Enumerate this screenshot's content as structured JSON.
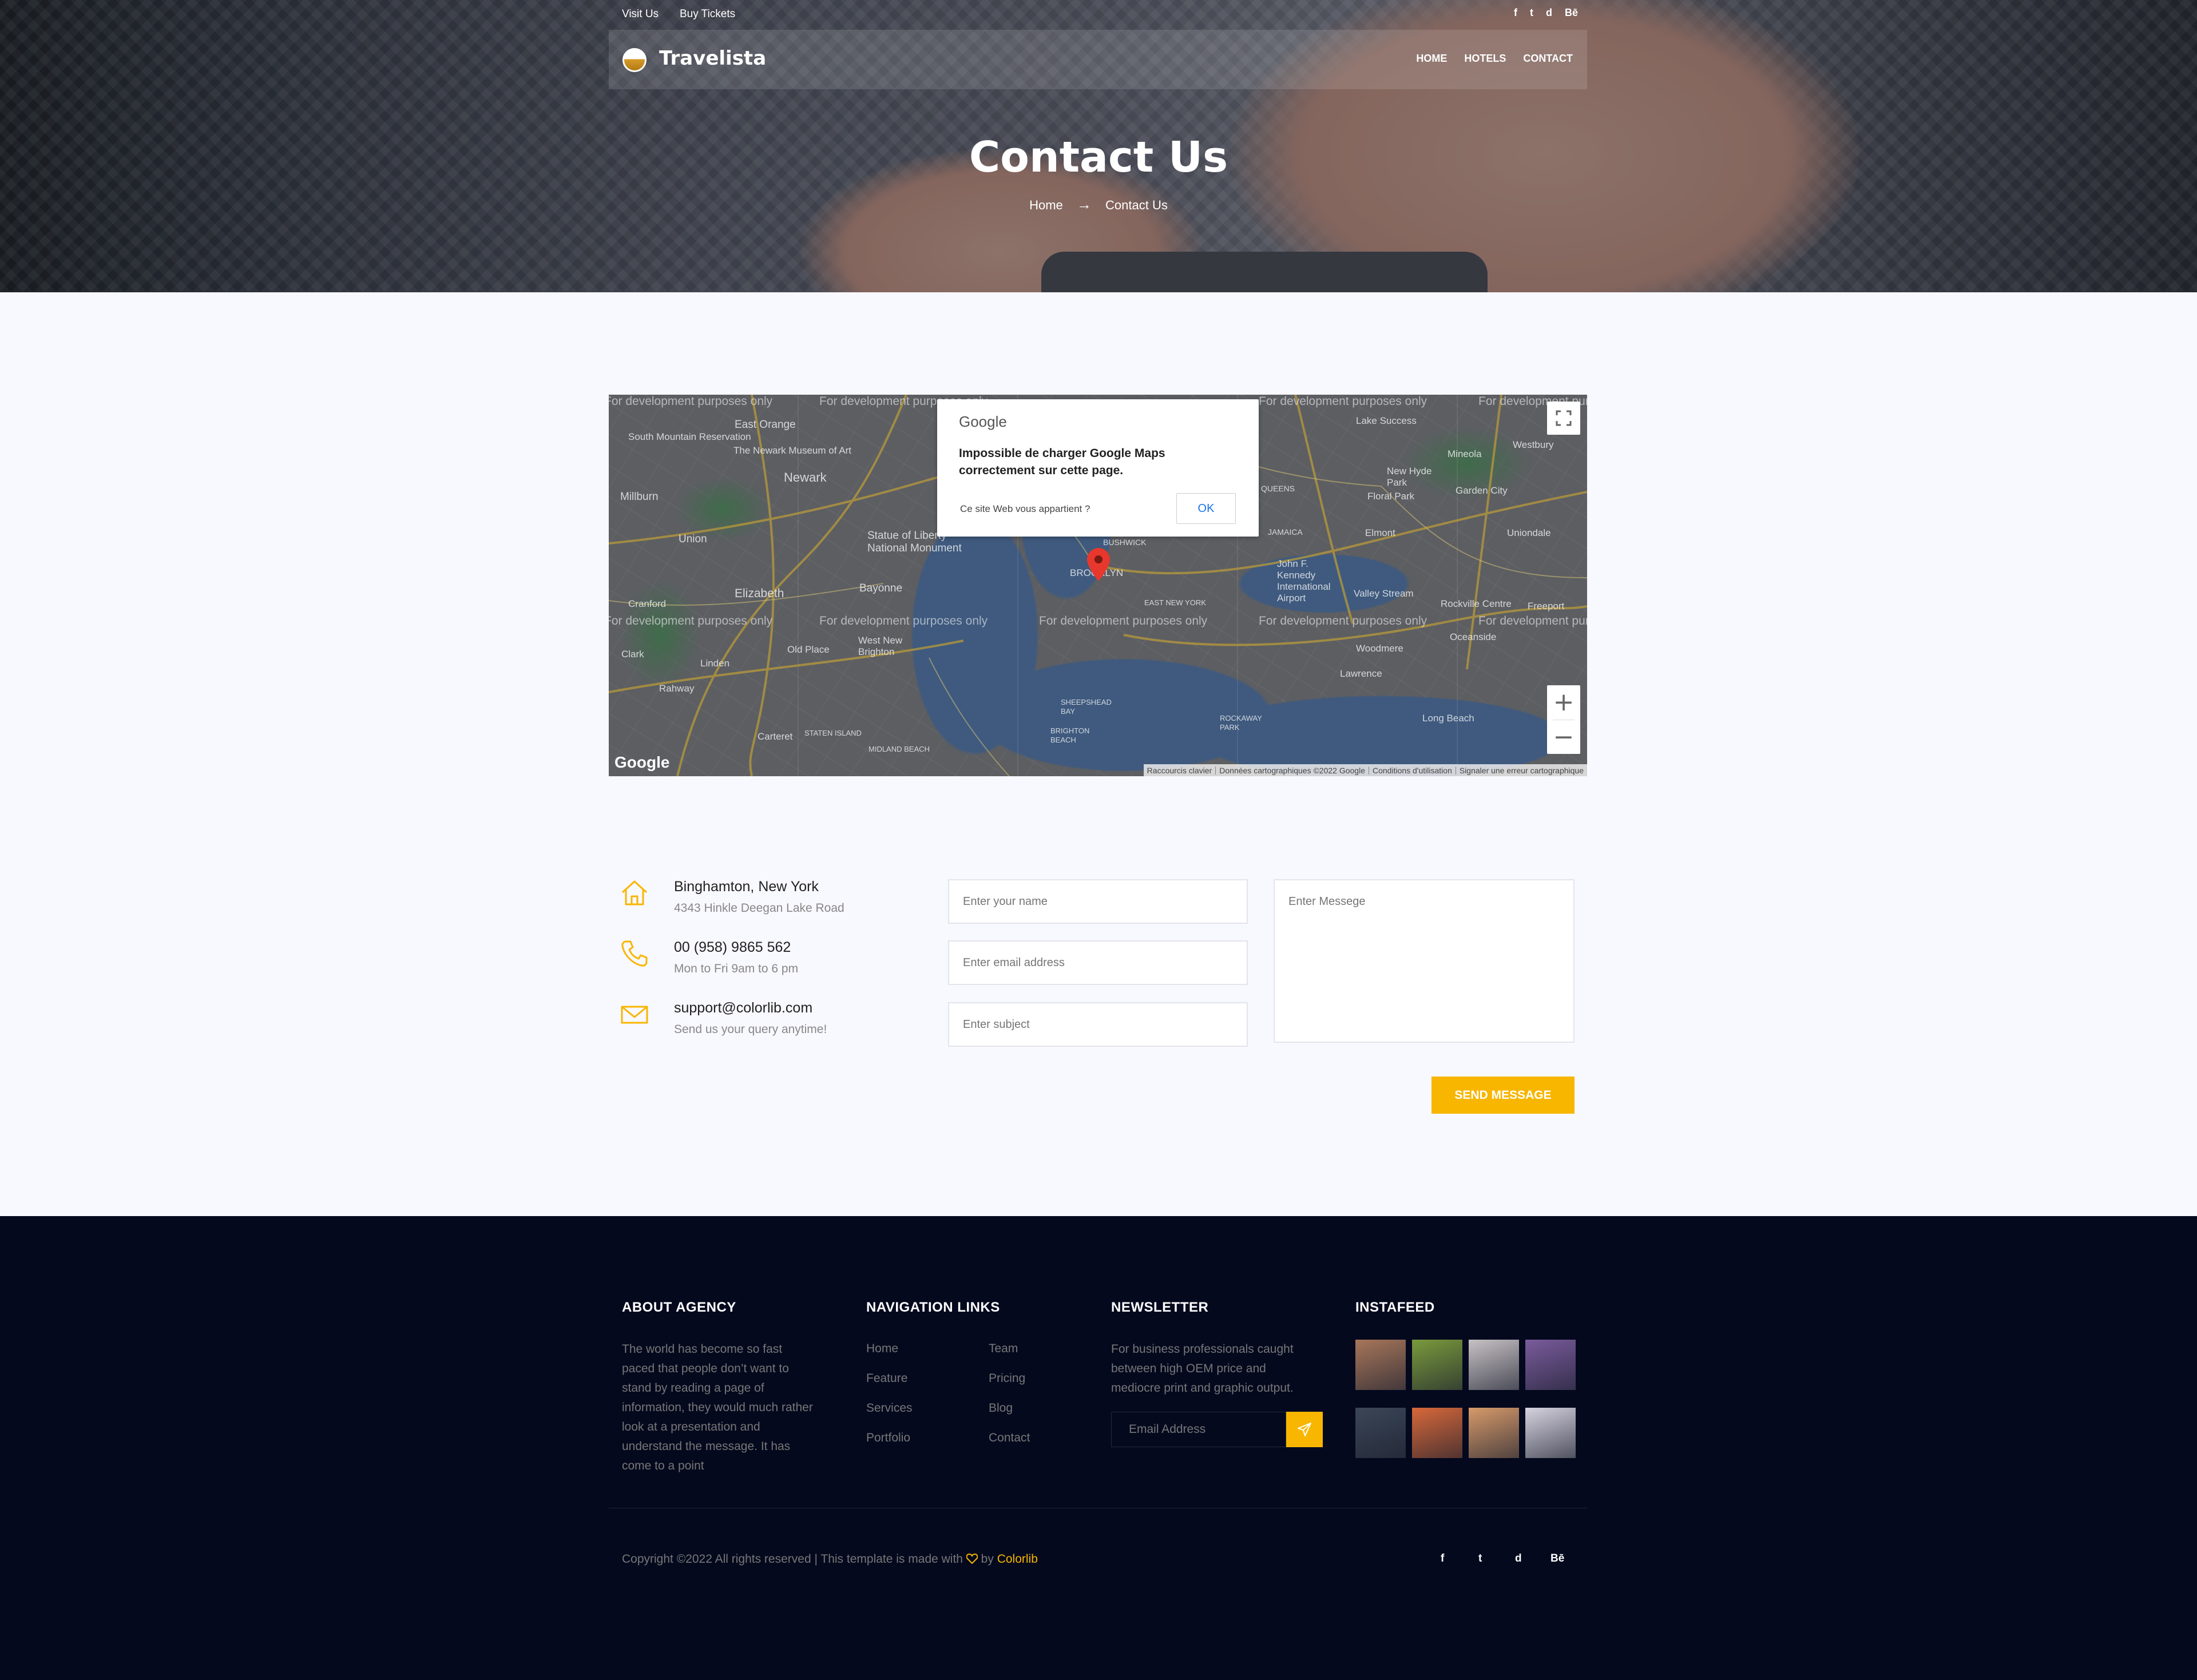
{
  "topbar": {
    "links": [
      "Visit Us",
      "Buy Tickets"
    ],
    "social": [
      "f",
      "t",
      "d",
      "Bē"
    ]
  },
  "navbar": {
    "brand": "Travelista",
    "menu": [
      "HOME",
      "HOTELS",
      "CONTACT"
    ]
  },
  "hero": {
    "title": "Contact Us",
    "breadcrumb": [
      "Home",
      "Contact Us"
    ],
    "breadcrumb_separator_icon": "arrow-right-icon"
  },
  "map": {
    "watermark": "For development purposes only",
    "places": [
      "East Orange",
      "South Mountain Reservation",
      "The Newark Museum of Art",
      "Newark",
      "Millburn",
      "Union",
      "Elizabeth",
      "Cranford",
      "Clark",
      "Linden",
      "Rahway",
      "Carteret",
      "Statue of Liberty National Monument",
      "Bayonne",
      "West New Brighton",
      "Old Place",
      "BUSHWICK",
      "BROOKLYN",
      "EAST NEW YORK",
      "QUEENS",
      "JAMAICA",
      "Lake Success",
      "Westbury",
      "Mineola",
      "New Hyde Park",
      "Floral Park",
      "Garden City",
      "Elmont",
      "Uniondale",
      "John F. Kennedy International Airport",
      "Valley Stream",
      "Rockville Centre",
      "Freeport",
      "Oceanside",
      "Woodmere",
      "Lawrence",
      "Long Beach",
      "STATEN ISLAND",
      "MIDLAND BEACH",
      "SHEEPSHEAD BAY",
      "BRIGHTON BEACH",
      "ROCKAWAY PARK"
    ],
    "dialog": {
      "brand": "Google",
      "message": "Impossible de charger Google Maps correctement sur cette page.",
      "owner_question": "Ce site Web vous appartient ?",
      "ok_label": "OK"
    },
    "google_logo": "Google",
    "footer_links": [
      "Raccourcis clavier",
      "Données cartographiques ©2022 Google",
      "Conditions d'utilisation",
      "Signaler une erreur cartographique"
    ],
    "zoom_in": "+",
    "zoom_out": "−"
  },
  "contact": {
    "items": [
      {
        "icon": "home-icon",
        "title": "Binghamton, New York",
        "sub": "4343 Hinkle Deegan Lake Road"
      },
      {
        "icon": "phone-icon",
        "title": "00 (958) 9865 562",
        "sub": "Mon to Fri 9am to 6 pm"
      },
      {
        "icon": "mail-icon",
        "title": "support@colorlib.com",
        "sub": "Send us your query anytime!"
      }
    ],
    "form": {
      "name_placeholder": "Enter your name",
      "email_placeholder": "Enter email address",
      "subject_placeholder": "Enter subject",
      "message_placeholder": "Enter Messege",
      "send_label": "Send Message"
    }
  },
  "footer": {
    "about": {
      "heading": "ABOUT AGENCY",
      "lines": [
        "The world has become so fast",
        "paced that people don’t want to",
        "stand by reading a page of",
        "information, they would much rather",
        "look at a presentation and",
        "understand the message. It has",
        "come to a point"
      ]
    },
    "nav": {
      "heading": "NAVIGATION LINKS",
      "col1": [
        "Home",
        "Feature",
        "Services",
        "Portfolio"
      ],
      "col2": [
        "Team",
        "Pricing",
        "Blog",
        "Contact"
      ]
    },
    "newsletter": {
      "heading": "NEWSLETTER",
      "lines": [
        "For business professionals caught",
        "between high OEM price and",
        "mediocre print and graphic output."
      ],
      "placeholder": "Email Address",
      "button_icon": "paper-plane-icon"
    },
    "instafeed": {
      "heading": "INSTAFEED",
      "colors": [
        "#a7765a",
        "#7a9a3c",
        "#c7c1c4",
        "#7a5b9c",
        "#3b4657",
        "#d7683a",
        "#d69a6a",
        "#d7d3e0"
      ]
    },
    "copyright": {
      "prefix": "Copyright ©2022 All rights reserved | This template is made with",
      "by": "by",
      "brand": "Colorlib"
    },
    "social": [
      "f",
      "t",
      "d",
      "Bē"
    ]
  },
  "colors": {
    "accent": "#f8b600",
    "footer_bg": "#04091e",
    "page_bg": "#f8f8ff"
  }
}
